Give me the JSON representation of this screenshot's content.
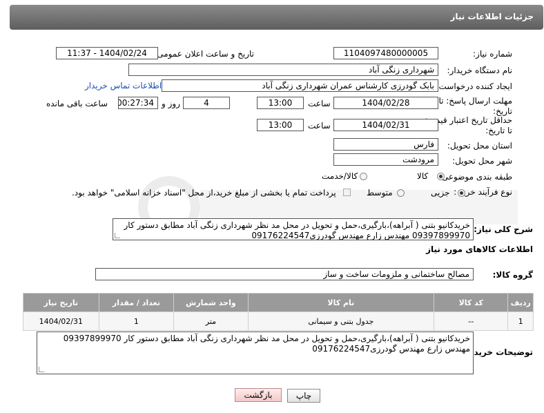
{
  "header": {
    "title": "جزئیات اطلاعات نیاز"
  },
  "fields": {
    "need_number_label": "شماره نیاز:",
    "need_number": "1104097480000005",
    "announce_label": "تاریخ و ساعت اعلان عمومی:",
    "announce_value": "1404/02/24 - 11:37",
    "buyer_org_label": "نام دستگاه خریدار:",
    "buyer_org": "شهرداری زنگی آباد",
    "requester_label": "ایجاد کننده درخواست:",
    "requester": "بابک گودرزی کارشناس عمران شهرداری زنگی آباد",
    "buyer_contact_link": "اطلاعات تماس خریدار",
    "deadline_label": "مهلت ارسال پاسخ: تا تاریخ:",
    "deadline_date": "1404/02/28",
    "time_label": "ساعت",
    "deadline_time": "13:00",
    "day_label": "روز و",
    "days_value": "4",
    "remaining_time": "00:27:34",
    "remaining_label": "ساعت باقی مانده",
    "min_price_label": "حداقل تاریخ اعتبار قیمت: تا تاریخ:",
    "price_date": "1404/02/31",
    "price_time": "13:00",
    "province_label": "استان محل تحویل:",
    "province": "فارس",
    "city_label": "شهر محل تحویل:",
    "city": "مرودشت",
    "category_label": "طبقه بندی موضوعی:",
    "cat_goods": "کالا",
    "cat_service": "کالا/خدمت",
    "purchase_type_label": "نوع فرآیند خرید :",
    "ptype_small": "جزیی",
    "ptype_medium": "متوسط",
    "payment_note": "پرداخت تمام یا بخشی از مبلغ خرید،از محل \"اسناد خزانه اسلامی\" خواهد بود."
  },
  "description": {
    "label": "شرح کلی نیاز:",
    "text": "خریدکانیو بتنی ( آبراهه)،بارگیری،حمل و تحویل در محل مد نظر شهرداری زنگی آباد  مطابق دستور کار 09397899970 مهندس زارع مهندس گودرزی09176224547"
  },
  "goods_section": {
    "title": "اطلاعات کالاهای مورد نیاز",
    "group_label": "گروه کالا:",
    "group_value": "مصالح ساختمانی و ملزومات ساخت و ساز"
  },
  "table": {
    "headers": [
      "ردیف",
      "کد کالا",
      "نام کالا",
      "واحد شمارش",
      "تعداد / مقدار",
      "تاریخ نیاز"
    ],
    "rows": [
      [
        "1",
        "--",
        "جدول بتنی و سیمانی",
        "متر",
        "1",
        "1404/02/31"
      ]
    ]
  },
  "buyer_notes": {
    "label": "توضیحات خریدار:",
    "text": "خریدکانیو بتنی ( آبراهه)،بارگیری،حمل و تحویل در محل مد نظر شهرداری زنگی آباد  مطابق دستور کار 09397899970 مهندس زارع مهندس گودرزی09176224547"
  },
  "buttons": {
    "print": "چاپ",
    "back": "بازگشت"
  }
}
